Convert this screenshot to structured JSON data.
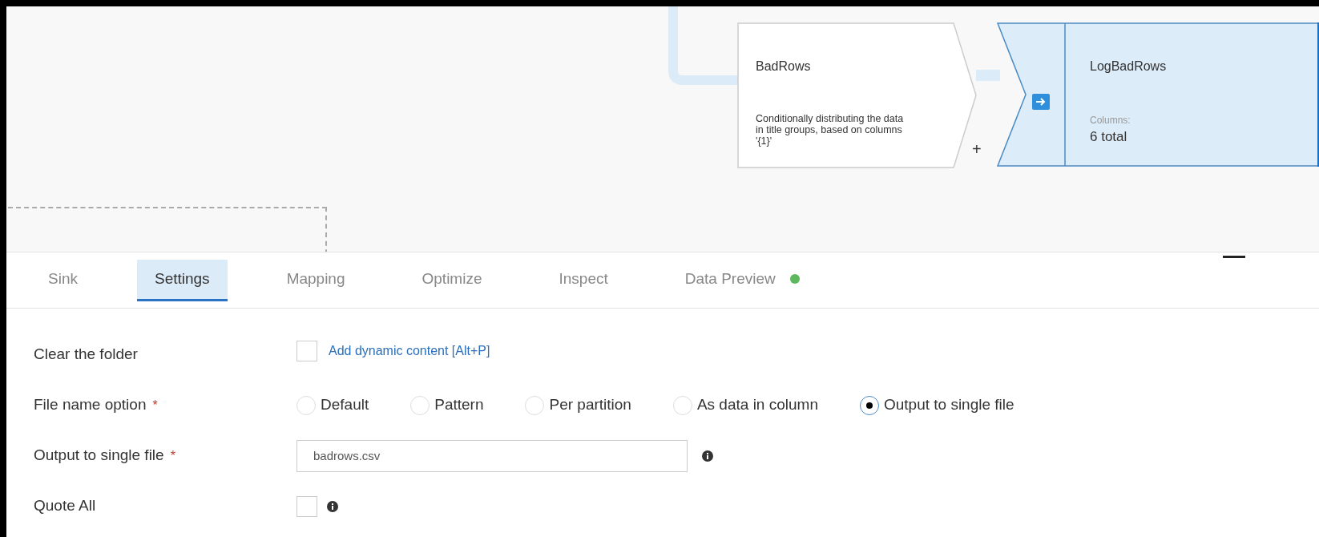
{
  "canvas": {
    "nodes": [
      {
        "kind": "split",
        "title": "BadRows",
        "description": "Conditionally distributing the data in title groups, based on columns '{1}'",
        "add_mark": "+"
      },
      {
        "kind": "sink",
        "title": "LogBadRows",
        "caption": "Columns:",
        "value": "6 total",
        "selected": true
      }
    ]
  },
  "tabs": [
    {
      "label": "Sink",
      "selected": false
    },
    {
      "label": "Settings",
      "selected": true
    },
    {
      "label": "Mapping",
      "selected": false
    },
    {
      "label": "Optimize",
      "selected": false
    },
    {
      "label": "Inspect",
      "selected": false
    },
    {
      "label": "Data Preview",
      "selected": false,
      "color": "#5cb85c"
    }
  ],
  "settings": [
    {
      "kind": "checkbox",
      "label": "Clear the folder",
      "checked": false,
      "link": "Add dynamic content [Alt+P]"
    },
    {
      "kind": "radio",
      "label": "File name option",
      "required_mark": "*",
      "options": [
        {
          "label": "Default",
          "selected": false
        },
        {
          "label": "Pattern",
          "selected": false
        },
        {
          "label": "Per partition",
          "selected": false
        },
        {
          "label": "As data in column",
          "selected": false
        },
        {
          "label": "Output to single file",
          "selected": true
        }
      ]
    },
    {
      "kind": "text",
      "label": "Output to single file",
      "required_mark": "*",
      "value": "badrows.csv",
      "info": true
    },
    {
      "kind": "checkbox",
      "label": "Quote All",
      "checked": false,
      "info": true
    }
  ]
}
